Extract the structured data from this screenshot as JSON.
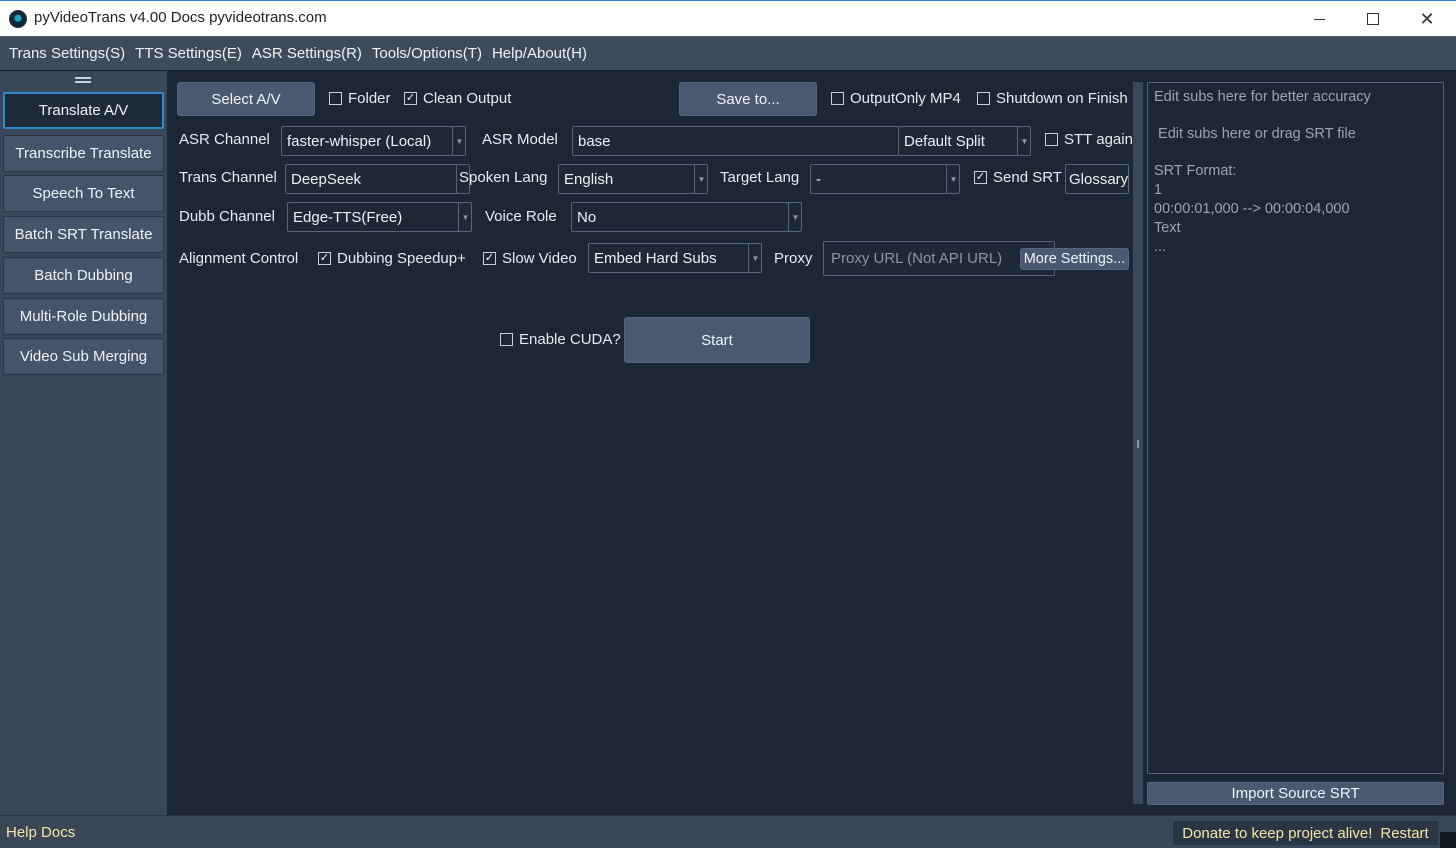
{
  "window": {
    "title": "pyVideoTrans v4.00 Docs pyvideotrans.com",
    "minimize": "",
    "maximize": "",
    "close": "✕"
  },
  "menu": [
    "Trans Settings(S)",
    "TTS Settings(E)",
    "ASR Settings(R)",
    "Tools/Options(T)",
    "Help/About(H)"
  ],
  "sidebar": {
    "items": [
      {
        "label": "Translate A/V",
        "active": true
      },
      {
        "label": "Transcribe Translate",
        "active": false
      },
      {
        "label": "Speech To Text",
        "active": false
      },
      {
        "label": "Batch SRT Translate",
        "active": false
      },
      {
        "label": "Batch Dubbing",
        "active": false
      },
      {
        "label": "Multi-Role Dubbing",
        "active": false
      },
      {
        "label": "Video Sub Merging",
        "active": false
      }
    ]
  },
  "row1": {
    "select_av": "Select A/V",
    "folder": {
      "label": "Folder",
      "checked": false
    },
    "clean_output": {
      "label": "Clean Output",
      "checked": true
    },
    "save_to": "Save to...",
    "output_only_mp4": {
      "label": "OutputOnly MP4",
      "checked": false
    },
    "shutdown": {
      "label": "Shutdown on Finish",
      "checked": false
    }
  },
  "row2": {
    "asr_channel_label": "ASR  Channel",
    "asr_channel_value": "faster-whisper (Local)",
    "asr_model_label": "ASR Model",
    "asr_model_value": "base",
    "split_value": "Default Split",
    "stt_again": {
      "label": "STT again",
      "checked": false
    }
  },
  "row3": {
    "trans_channel_label": "Trans Channel",
    "trans_channel_value": "DeepSeek",
    "spoken_lang_label": "Spoken Lang",
    "spoken_lang_value": "English",
    "target_lang_label": "Target Lang",
    "target_lang_value": "-",
    "send_srt": {
      "label": "Send SRT",
      "checked": true
    },
    "glossary": "Glossary"
  },
  "row4": {
    "dubb_channel_label": "Dubb Channel",
    "dubb_channel_value": "Edge-TTS(Free)",
    "voice_role_label": "Voice Role",
    "voice_role_value": "No"
  },
  "row5": {
    "alignment_label": "Alignment Control",
    "dubbing_speedup": {
      "label": "Dubbing Speedup+",
      "checked": true
    },
    "slow_video": {
      "label": "Slow Video",
      "checked": true
    },
    "subs_mode_value": "Embed Hard Subs",
    "proxy_label": "Proxy",
    "proxy_placeholder": "Proxy URL (Not API URL)",
    "more_settings": "More Settings..."
  },
  "row6": {
    "enable_cuda": {
      "label": "Enable CUDA?",
      "checked": false
    },
    "start": "Start"
  },
  "right_panel": {
    "srt_placeholder_lines": [
      "Edit subs here for better accuracy",
      "",
      " Edit subs here or drag SRT file",
      "",
      "SRT Format:",
      "1",
      "00:00:01,000 --> 00:00:04,000",
      "Text",
      "..."
    ],
    "import_button": "Import Source SRT"
  },
  "status": {
    "help_docs": "Help Docs",
    "donate": "Donate to keep project alive!",
    "restart": "Restart"
  },
  "colors": {
    "background": "#1c2634",
    "sidebar": "#3a4758",
    "button": "#4a5870",
    "accent": "#2f8bd0",
    "status_text": "#f4e6a0"
  }
}
